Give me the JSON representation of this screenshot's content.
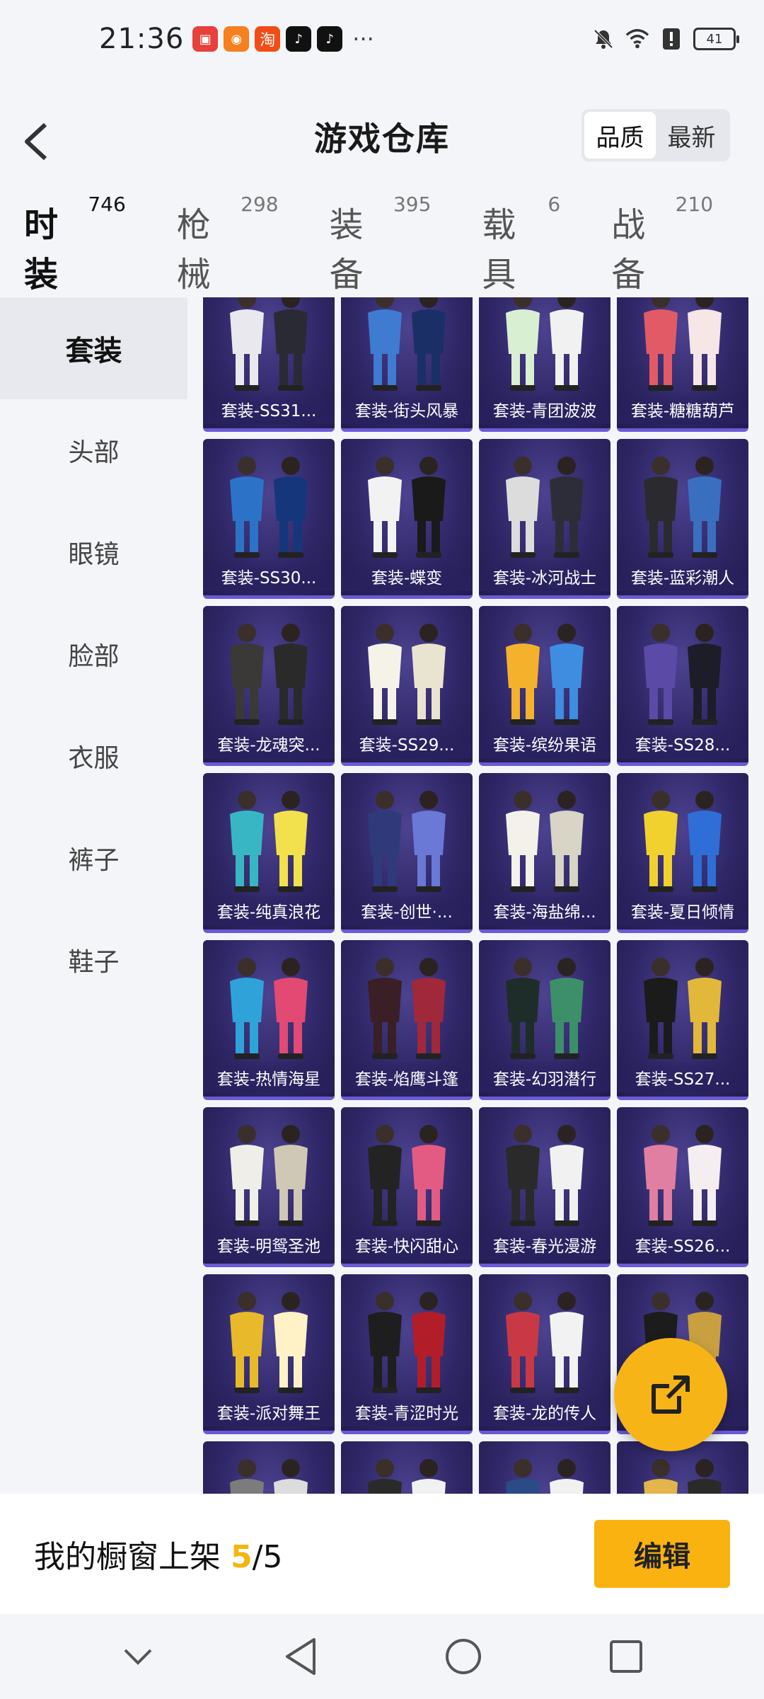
{
  "status_bar": {
    "time": "21:36",
    "battery": "41"
  },
  "header": {
    "title": "游戏仓库",
    "sort_options": [
      {
        "label": "品质",
        "active": true
      },
      {
        "label": "最新",
        "active": false
      }
    ]
  },
  "categories": [
    {
      "label": "时装",
      "count": "746",
      "active": true
    },
    {
      "label": "枪械",
      "count": "298",
      "active": false
    },
    {
      "label": "装备",
      "count": "395",
      "active": false
    },
    {
      "label": "载具",
      "count": "6",
      "active": false
    },
    {
      "label": "战备",
      "count": "210",
      "active": false
    }
  ],
  "sidebar": {
    "items": [
      {
        "label": "套装",
        "active": true
      },
      {
        "label": "头部",
        "active": false
      },
      {
        "label": "眼镜",
        "active": false
      },
      {
        "label": "脸部",
        "active": false
      },
      {
        "label": "衣服",
        "active": false
      },
      {
        "label": "裤子",
        "active": false
      },
      {
        "label": "鞋子",
        "active": false
      }
    ]
  },
  "grid": {
    "items": [
      {
        "label": "套装-SS31..."
      },
      {
        "label": "套装-街头风暴"
      },
      {
        "label": "套装-青团波波"
      },
      {
        "label": "套装-糖糖葫芦"
      },
      {
        "label": "套装-SS30..."
      },
      {
        "label": "套装-蝶变"
      },
      {
        "label": "套装-冰河战士"
      },
      {
        "label": "套装-蓝彩潮人"
      },
      {
        "label": "套装-龙魂突..."
      },
      {
        "label": "套装-SS29..."
      },
      {
        "label": "套装-缤纷果语"
      },
      {
        "label": "套装-SS28..."
      },
      {
        "label": "套装-纯真浪花"
      },
      {
        "label": "套装-创世·..."
      },
      {
        "label": "套装-海盐绵..."
      },
      {
        "label": "套装-夏日倾情"
      },
      {
        "label": "套装-热情海星"
      },
      {
        "label": "套装-焰鹰斗篷"
      },
      {
        "label": "套装-幻羽潜行"
      },
      {
        "label": "套装-SS27..."
      },
      {
        "label": "套装-明鸳圣池"
      },
      {
        "label": "套装-快闪甜心"
      },
      {
        "label": "套装-春光漫游"
      },
      {
        "label": "套装-SS26..."
      },
      {
        "label": "套装-派对舞王"
      },
      {
        "label": "套装-青涩时光"
      },
      {
        "label": "套装-龙的传人"
      },
      {
        "label": ""
      },
      {
        "label": ""
      },
      {
        "label": ""
      },
      {
        "label": ""
      },
      {
        "label": ""
      }
    ]
  },
  "bottom": {
    "shelf_label": "我的橱窗上架",
    "shelf_count": "5",
    "shelf_sep": "/",
    "shelf_total": "5",
    "edit_label": "编辑"
  },
  "colors": {
    "accent": "#f7b416",
    "card_bg": "#2f2767"
  }
}
